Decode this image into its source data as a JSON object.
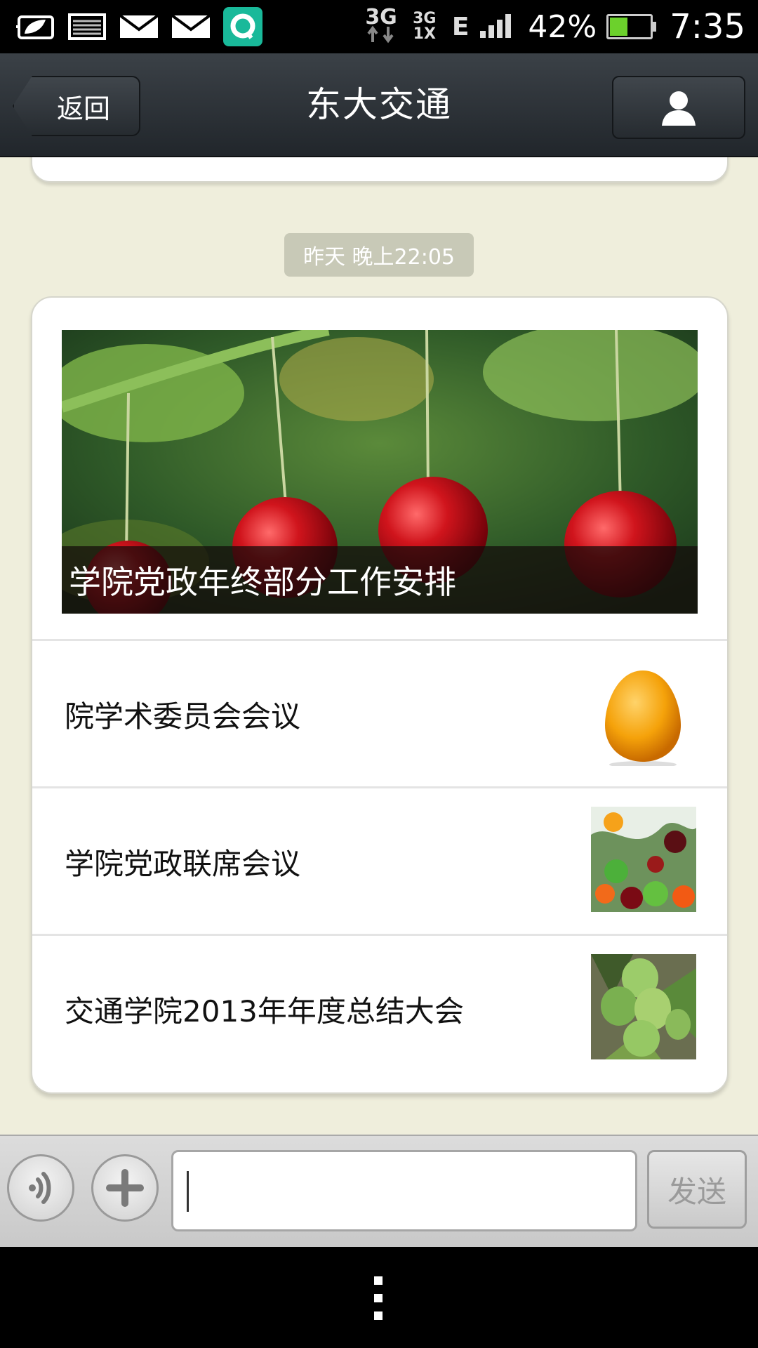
{
  "status_bar": {
    "network_3g": "3G",
    "network_1x": "3G\n1X",
    "network_edge": "E",
    "battery_percent": "42%",
    "battery_level": 0.42,
    "time": "7:35",
    "icons": [
      "leaf-icon",
      "image-icon",
      "mail-icon",
      "mail-icon",
      "app-q-icon",
      "data-arrows-icon",
      "signal-icon",
      "battery-icon"
    ]
  },
  "header": {
    "back_label": "返回",
    "title": "东大交通",
    "profile_icon": "person-icon"
  },
  "chat": {
    "timestamp": "昨天 晚上22:05",
    "article_card": {
      "cover_title": "学院党政年终部分工作安排",
      "items": [
        {
          "title": "院学术委员会会议",
          "thumb": "orange"
        },
        {
          "title": "学院党政联席会议",
          "thumb": "mixed-fruit"
        },
        {
          "title": "交通学院2013年年度总结大会",
          "thumb": "figs"
        }
      ]
    }
  },
  "input_bar": {
    "voice_icon": "voice-icon",
    "plus_icon": "plus-icon",
    "input_value": "",
    "send_label": "发送"
  },
  "colors": {
    "chat_background": "#efeedc",
    "titlebar": "#2d3237",
    "timestamp_bg": "#c8c9b7"
  }
}
